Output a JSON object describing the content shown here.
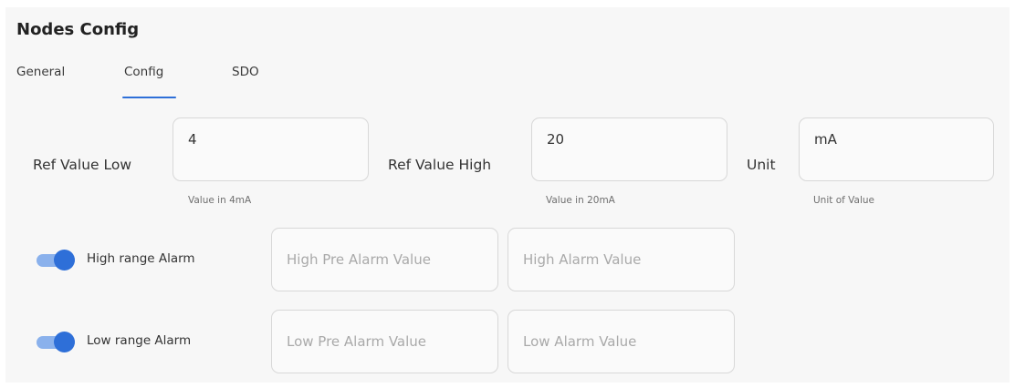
{
  "title": "Nodes Config",
  "tabs": [
    {
      "label": "General",
      "active": false
    },
    {
      "label": "Config",
      "active": true
    },
    {
      "label": "SDO",
      "active": false
    }
  ],
  "accent_color": "#2e6fd8",
  "ref_low": {
    "label": "Ref Value Low",
    "value": "4",
    "helper": "Value in 4mA"
  },
  "ref_high": {
    "label": "Ref Value High",
    "value": "20",
    "helper": "Value in 20mA"
  },
  "unit": {
    "label": "Unit",
    "value": "mA",
    "helper": "Unit of Value"
  },
  "high_alarm": {
    "label": "High range Alarm",
    "enabled": true,
    "pre_alarm_placeholder": "High Pre Alarm Value",
    "alarm_placeholder": "High Alarm Value"
  },
  "low_alarm": {
    "label": "Low range Alarm",
    "enabled": true,
    "pre_alarm_placeholder": "Low Pre Alarm Value",
    "alarm_placeholder": "Low Alarm Value"
  }
}
